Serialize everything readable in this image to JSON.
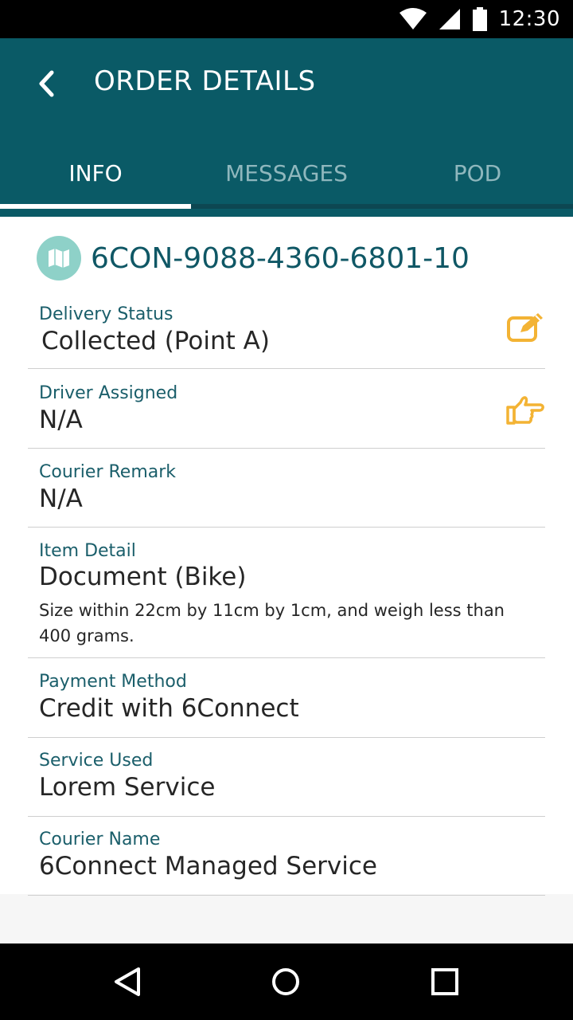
{
  "status_bar": {
    "time": "12:30"
  },
  "app_bar": {
    "title": "ORDER DETAILS",
    "back_icon": "chevron-left-icon"
  },
  "tabs": [
    {
      "label": "INFO",
      "active": true
    },
    {
      "label": "MESSAGES",
      "active": false
    },
    {
      "label": "POD",
      "active": false
    }
  ],
  "order": {
    "id": "6CON-9088-4360-6801-10",
    "icon": "map-icon"
  },
  "fields": {
    "delivery_status": {
      "label": "Delivery Status",
      "value": "Collected (Point A)",
      "action_icon": "edit-icon"
    },
    "driver_assigned": {
      "label": "Driver Assigned",
      "value": "N/A",
      "action_icon": "pointing-hand-icon"
    },
    "courier_remark": {
      "label": "Courier Remark",
      "value": "N/A"
    },
    "item_detail": {
      "label": "Item Detail",
      "value": "Document (Bike)",
      "description": "Size within 22cm by 11cm by 1cm, and weigh less than 400 grams."
    },
    "payment_method": {
      "label": "Payment Method",
      "value": "Credit with 6Connect"
    },
    "service_used": {
      "label": "Service Used",
      "value": "Lorem Service"
    },
    "courier_name": {
      "label": "Courier Name",
      "value": "6Connect Managed Service"
    }
  },
  "colors": {
    "app_bar": "#0a5a66",
    "accent_icon": "#f3b334",
    "label": "#1a5e6a",
    "map_badge": "#8ed1c8"
  },
  "nav_bar": {
    "back_icon": "triangle-back-icon",
    "home_icon": "circle-home-icon",
    "recents_icon": "square-recents-icon"
  }
}
